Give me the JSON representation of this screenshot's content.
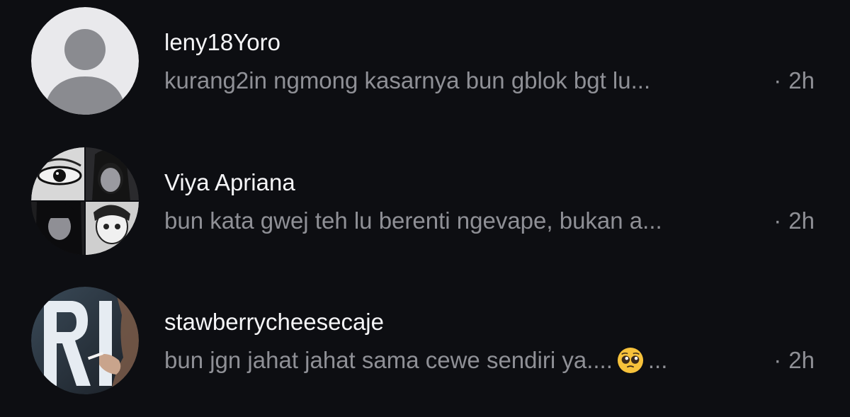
{
  "comments": [
    {
      "username": "leny18Yoro",
      "preview": "kurang2in ngmong kasarnya bun gblok bgt lu...",
      "separator": "·",
      "time": "2h",
      "avatar": "default-avatar-icon"
    },
    {
      "username": "Viya Apriana",
      "preview": "bun kata gwej teh lu berenti ngevape, bukan a...",
      "separator": "·",
      "time": "2h",
      "avatar": "photo-collage-avatar"
    },
    {
      "username": "stawberrycheesecaje",
      "preview": "bun jgn jahat jahat sama cewe sendiri ya....",
      "preview_suffix": "...",
      "emoji": "pleading-face-emoji",
      "separator": "·",
      "time": "2h",
      "avatar": "photo-avatar"
    }
  ],
  "colors": {
    "background": "#0d0e12",
    "username": "#f5f5f7",
    "secondary": "#8f9096",
    "default_avatar_bg": "#e9e9ec",
    "default_avatar_fg": "#8a8b90"
  }
}
